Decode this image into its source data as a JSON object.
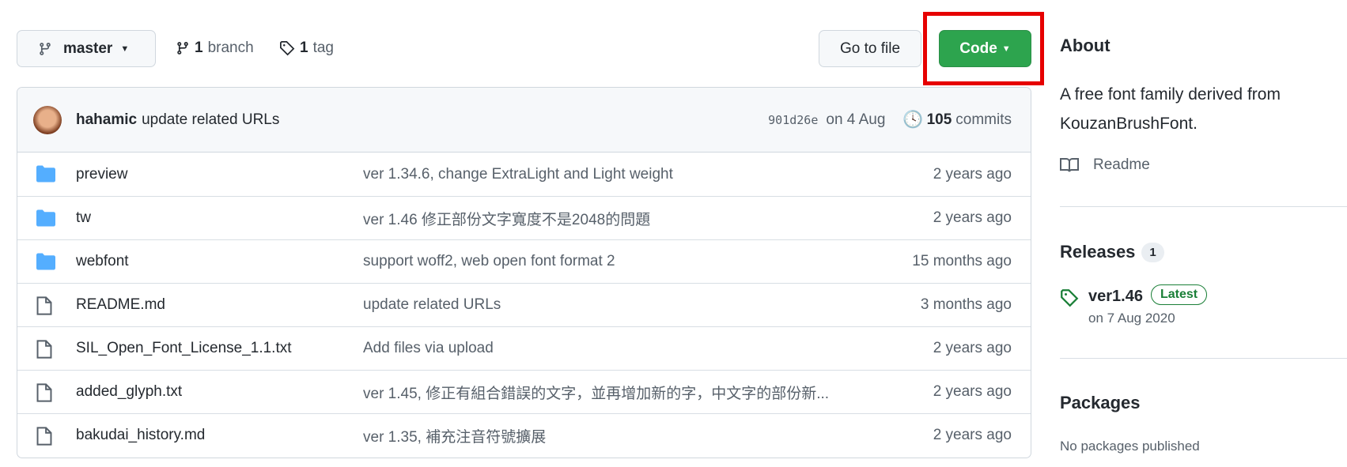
{
  "toolbar": {
    "branch_select": "master",
    "branch_count": "1",
    "branch_label": "branch",
    "tag_count": "1",
    "tag_label": "tag",
    "go_to_file": "Go to file",
    "code": "Code"
  },
  "commit": {
    "author": "hahamic",
    "message": "update related URLs",
    "sha": "901d26e",
    "date": "on 4 Aug",
    "count": "105",
    "count_label": "commits"
  },
  "files": [
    {
      "type": "folder",
      "name": "preview",
      "message": "ver 1.34.6, change ExtraLight and Light weight",
      "time": "2 years ago"
    },
    {
      "type": "folder",
      "name": "tw",
      "message": "ver 1.46 修正部份文字寬度不是2048的問題",
      "time": "2 years ago"
    },
    {
      "type": "folder",
      "name": "webfont",
      "message": "support woff2, web open font format 2",
      "time": "15 months ago"
    },
    {
      "type": "file",
      "name": "README.md",
      "message": "update related URLs",
      "time": "3 months ago"
    },
    {
      "type": "file",
      "name": "SIL_Open_Font_License_1.1.txt",
      "message": "Add files via upload",
      "time": "2 years ago"
    },
    {
      "type": "file",
      "name": "added_glyph.txt",
      "message": "ver 1.45, 修正有組合錯誤的文字，並再增加新的字，中文字的部份新...",
      "time": "2 years ago"
    },
    {
      "type": "file",
      "name": "bakudai_history.md",
      "message": "ver 1.35, 補充注音符號擴展",
      "time": "2 years ago"
    }
  ],
  "about": {
    "title": "About",
    "description": "A free font family derived from KouzanBrushFont.",
    "readme": "Readme"
  },
  "releases": {
    "title": "Releases",
    "count": "1",
    "tag": "ver1.46",
    "badge": "Latest",
    "date": "on 7 Aug 2020"
  },
  "packages": {
    "title": "Packages",
    "empty": "No packages published"
  },
  "colors": {
    "code_button": "#2da44e",
    "highlight": "#e60000",
    "folder": "#54aeff",
    "latest": "#1a7f37"
  }
}
